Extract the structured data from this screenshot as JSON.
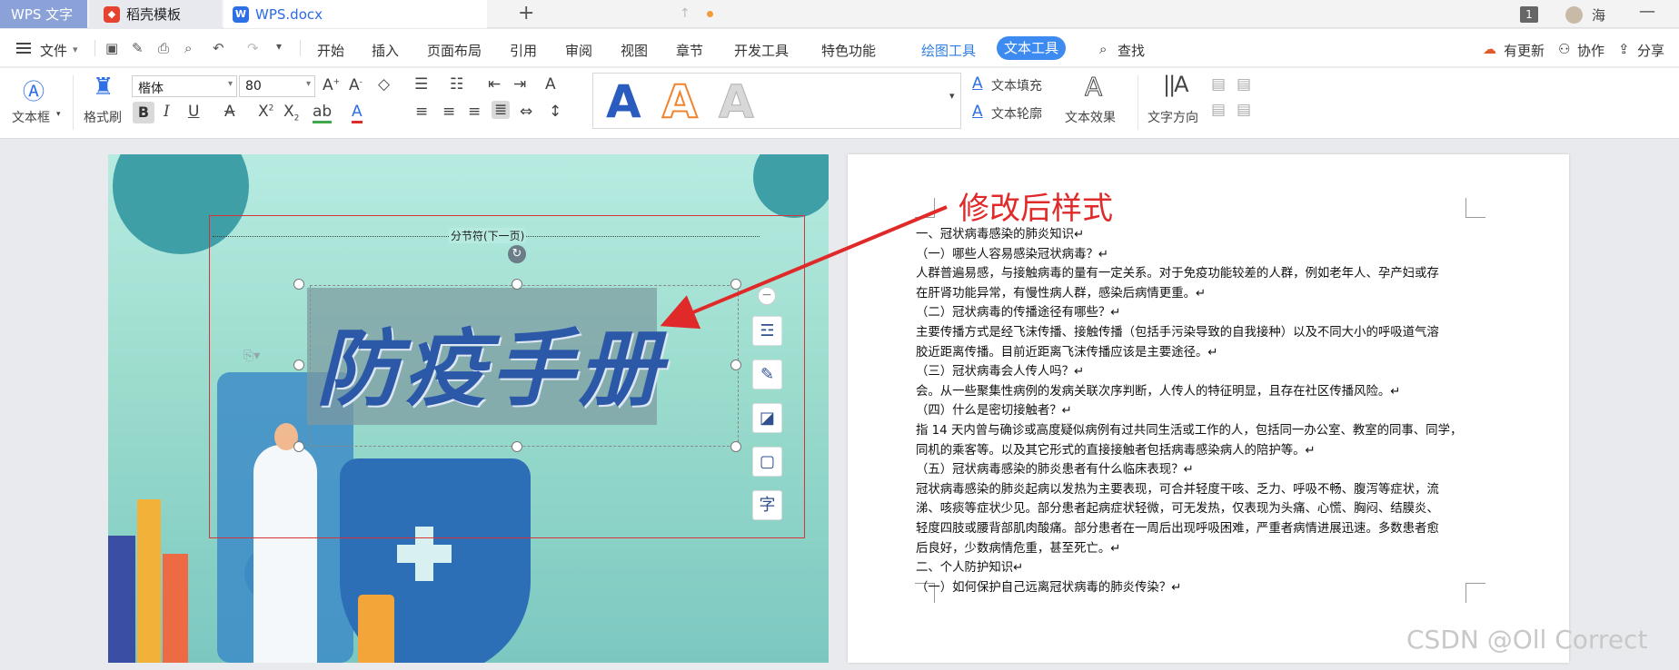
{
  "tabs": {
    "app": "WPS 文字",
    "template": "稻壳模板",
    "doc": "WPS.docx",
    "add": "+"
  },
  "titlebar": {
    "count_badge": "1",
    "user": "海",
    "minimize": "—"
  },
  "menu": {
    "file": "文件",
    "items": [
      "开始",
      "插入",
      "页面布局",
      "引用",
      "审阅",
      "视图",
      "章节",
      "开发工具",
      "特色功能"
    ],
    "drawing_tools": "绘图工具",
    "text_tools": "文本工具",
    "search": "查找",
    "update": "有更新",
    "collab": "协作",
    "share": "分享"
  },
  "ribbon": {
    "textbox": "文本框",
    "format_painter": "格式刷",
    "font_name": "楷体",
    "font_size": "80",
    "text_fill": "文本填充",
    "text_outline": "文本轮廓",
    "text_effect": "文本效果",
    "text_direction": "文字方向",
    "style_glyph": "A"
  },
  "cover": {
    "section_break": "分节符(下一页)",
    "title": "防疫手册"
  },
  "annotation": "修改后样式",
  "document_lines": [
    "一、冠状病毒感染的肺炎知识↵",
    "（一）哪些人容易感染冠状病毒？↵",
    "人群普遍易感，与接触病毒的量有一定关系。对于免疫功能较差的人群，例如老年人、孕产妇或存",
    "在肝肾功能异常，有慢性病人群，感染后病情更重。↵",
    "（二）冠状病毒的传播途径有哪些？↵",
    "主要传播方式是经飞沫传播、接触传播（包括手污染导致的自我接种）以及不同大小的呼吸道气溶",
    "胶近距离传播。目前近距离飞沫传播应该是主要途径。↵",
    "（三）冠状病毒会人传人吗？↵",
    "会。从一些聚集性病例的发病关联次序判断，人传人的特征明显，且存在社区传播风险。↵",
    "（四）什么是密切接触者？↵",
    "指 14 天内曾与确诊或高度疑似病例有过共同生活或工作的人，包括同一办公室、教室的同事、同学，",
    "同机的乘客等。以及其它形式的直接接触者包括病毒感染病人的陪护等。↵",
    "（五）冠状病毒感染的肺炎患者有什么临床表现？↵",
    "冠状病毒感染的肺炎起病以发热为主要表现，可合并轻度干咳、乏力、呼吸不畅、腹泻等症状，流",
    "涕、咳痰等症状少见。部分患者起病症状轻微，可无发热，仅表现为头痛、心慌、胸闷、结膜炎、",
    "轻度四肢或腰背部肌肉酸痛。部分患者在一周后出现呼吸困难，严重者病情进展迅速。多数患者愈",
    "后良好，少数病情危重，甚至死亡。↵",
    "二、个人防护知识↵",
    "（一）如何保护自己远离冠状病毒的肺炎传染？↵"
  ],
  "watermark": "CSDN @Oll Correct",
  "colors": {
    "accent": "#3d8bf0",
    "annotation": "#e02a2a",
    "title": "#2c58a8"
  }
}
